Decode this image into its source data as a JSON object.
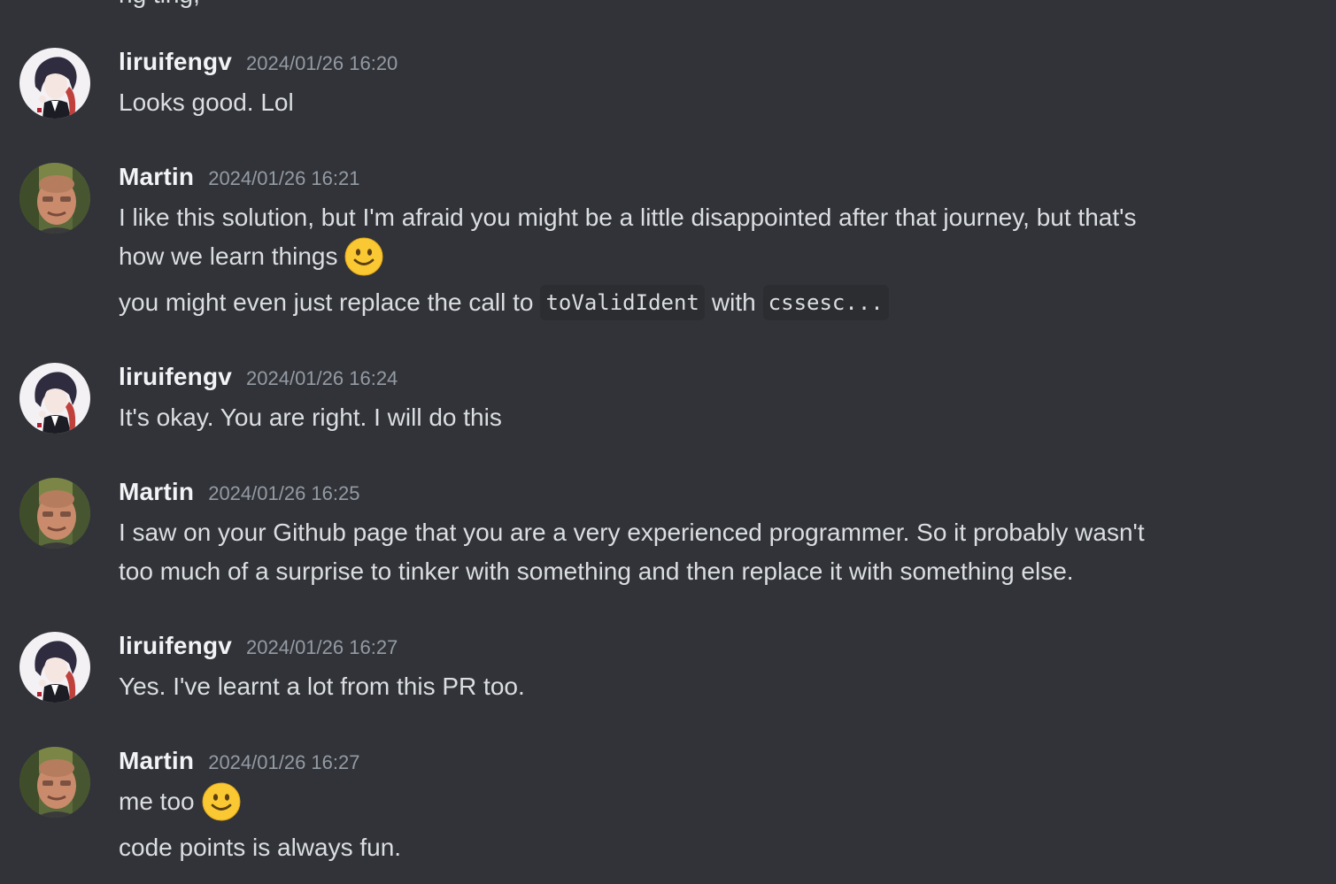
{
  "cutoff_text": "ng ting,",
  "messages": [
    {
      "author": "liruifengv",
      "time": "2024/01/26 16:20",
      "avatar": "anime-avatar",
      "lines": [
        "Looks good. Lol"
      ]
    },
    {
      "author": "Martin",
      "time": "2024/01/26 16:21",
      "avatar": "photo-avatar",
      "lines": [
        "I like this solution, but I'm afraid you might be a little disappointed after that journey, but that's",
        "how we learn things"
      ],
      "line3_prefix": "you might even just replace the call to",
      "line3_code1": "toValidIdent",
      "line3_mid": "with",
      "line3_code2": "cssesc..."
    },
    {
      "author": "liruifengv",
      "time": "2024/01/26 16:24",
      "avatar": "anime-avatar",
      "lines": [
        "It's okay. You are right. I will do this"
      ]
    },
    {
      "author": "Martin",
      "time": "2024/01/26 16:25",
      "avatar": "photo-avatar",
      "lines": [
        "I saw on your Github page that you are a very experienced programmer. So it probably wasn't",
        "too much of a surprise to tinker with something and then replace it with something else."
      ]
    },
    {
      "author": "liruifengv",
      "time": "2024/01/26 16:27",
      "avatar": "anime-avatar",
      "lines": [
        "Yes. I've learnt a lot from this PR too."
      ]
    },
    {
      "author": "Martin",
      "time": "2024/01/26 16:27",
      "avatar": "photo-avatar",
      "lines": [
        "me too",
        "code points is always fun."
      ]
    }
  ],
  "emoji": "slightly-smiling-face-icon",
  "colors": {
    "background": "#313338",
    "author": "#f2f3f5",
    "text": "#dbdee1",
    "timestamp": "#949ba4",
    "code_bg": "#2b2d31",
    "emoji": "#f9c832"
  }
}
